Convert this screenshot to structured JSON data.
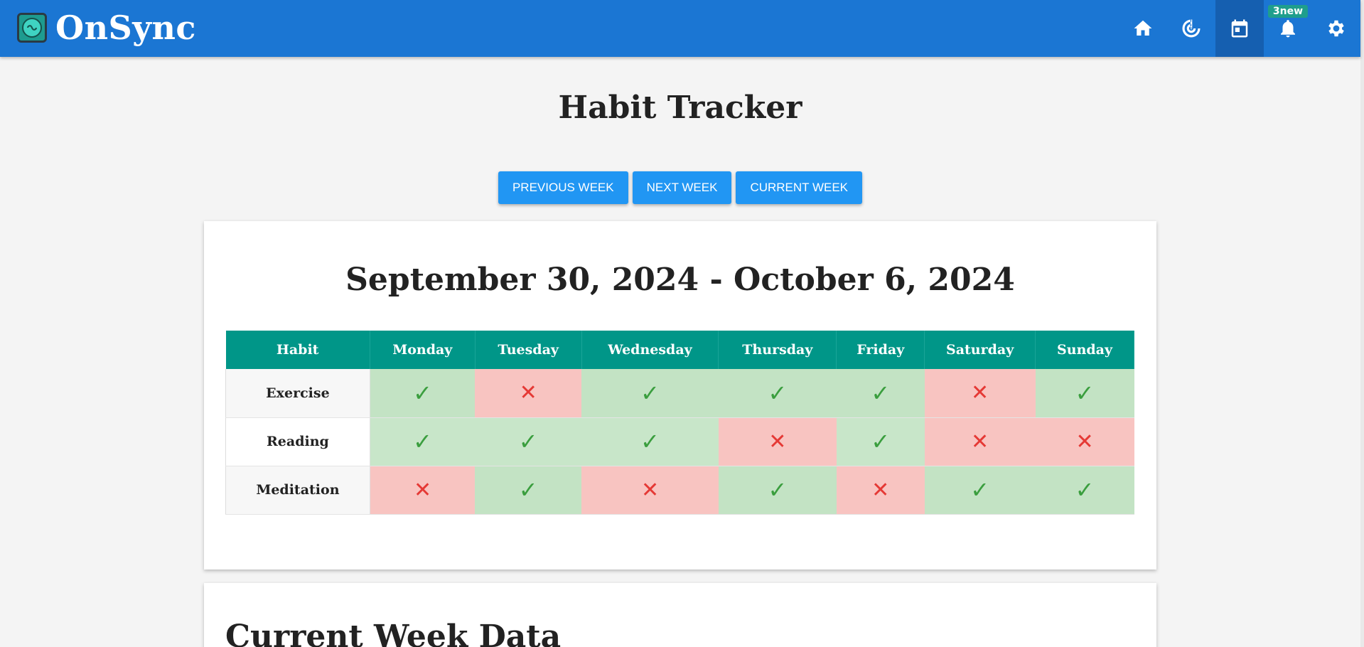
{
  "app": {
    "name": "OnSync"
  },
  "nav": [
    {
      "icon": "home-icon",
      "active": false
    },
    {
      "icon": "radar-icon",
      "active": false
    },
    {
      "icon": "calendar-icon",
      "active": true
    },
    {
      "icon": "bell-icon",
      "active": false,
      "badge": "3new"
    },
    {
      "icon": "gear-icon",
      "active": false
    }
  ],
  "page": {
    "title": "Habit Tracker"
  },
  "week_buttons": {
    "previous": "PREVIOUS WEEK",
    "next": "NEXT WEEK",
    "current": "CURRENT WEEK"
  },
  "tracker": {
    "range": "September 30, 2024 - October 6, 2024",
    "columns": [
      "Habit",
      "Monday",
      "Tuesday",
      "Wednesday",
      "Thursday",
      "Friday",
      "Saturday",
      "Sunday"
    ],
    "rows": [
      {
        "habit": "Exercise",
        "done": [
          true,
          false,
          true,
          true,
          true,
          false,
          true
        ]
      },
      {
        "habit": "Reading",
        "done": [
          true,
          true,
          true,
          false,
          true,
          false,
          false
        ]
      },
      {
        "habit": "Meditation",
        "done": [
          false,
          true,
          false,
          true,
          false,
          true,
          true
        ]
      }
    ],
    "marks": {
      "yes": "✓",
      "no": "✕"
    }
  },
  "current_week": {
    "title": "Current Week Data"
  },
  "colors": {
    "topbar": "#1b76d3",
    "accent": "#2196f3",
    "table_header": "#009688",
    "done": "#c8e6c9",
    "missed": "#f8c4c1"
  }
}
